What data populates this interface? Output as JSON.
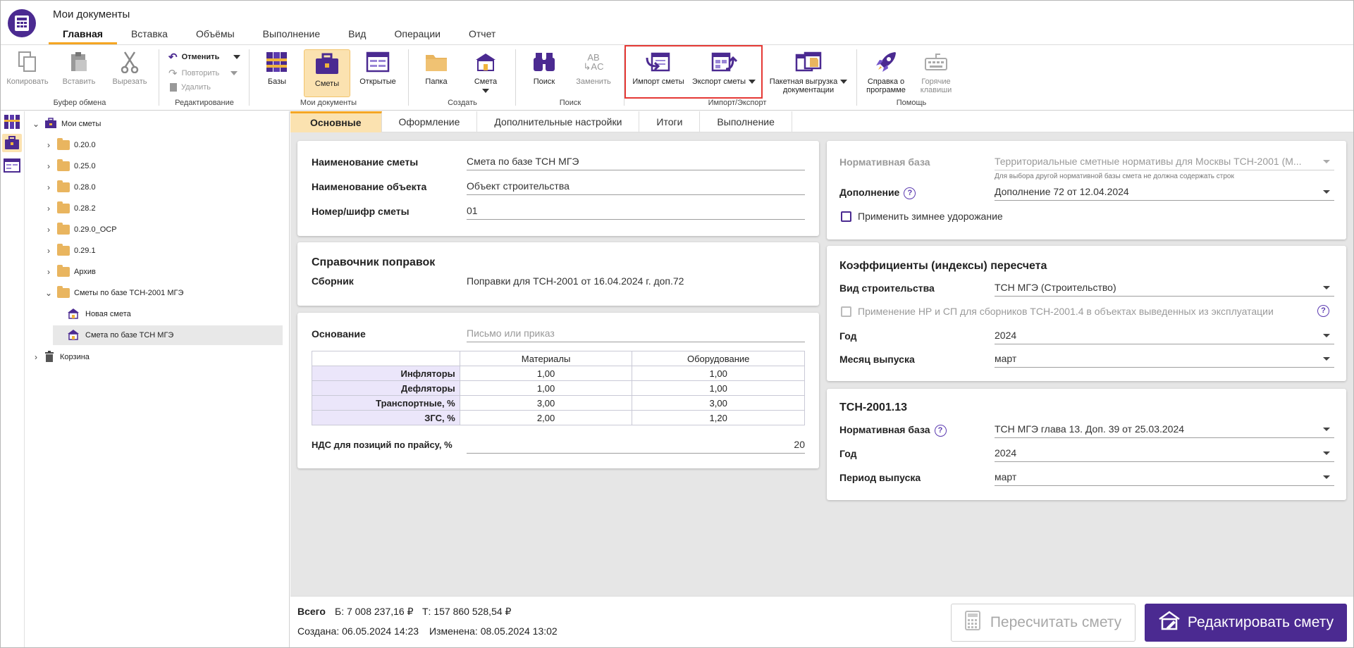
{
  "app": {
    "title": "Мои документы"
  },
  "ribbon_tabs": [
    "Главная",
    "Вставка",
    "Объёмы",
    "Выполнение",
    "Вид",
    "Операции",
    "Отчет"
  ],
  "ribbon": {
    "clipboard": {
      "copy": "Копировать",
      "paste": "Вставить",
      "cut": "Вырезать",
      "group": "Буфер обмена"
    },
    "editing": {
      "undo": "Отменить",
      "redo": "Повторить",
      "delete": "Удалить",
      "group": "Редактирование"
    },
    "my_docs": {
      "bases": "Базы",
      "estimates": "Сметы",
      "open": "Открытые",
      "group": "Мои документы"
    },
    "create": {
      "folder": "Папка",
      "estimate": "Смета",
      "group": "Создать"
    },
    "search": {
      "find": "Поиск",
      "replace": "Заменить",
      "group": "Поиск"
    },
    "import_export": {
      "import": "Импорт сметы",
      "export": "Экспорт сметы",
      "batch_line1": "Пакетная выгрузка",
      "batch_line2": "документации",
      "group": "Импорт/Экспорт"
    },
    "help": {
      "about_line1": "Справка о",
      "about_line2": "программе",
      "hotkeys_line1": "Горячие",
      "hotkeys_line2": "клавиши",
      "group": "Помощь"
    }
  },
  "tree": {
    "root": "Мои сметы",
    "folders": [
      "0.20.0",
      "0.25.0",
      "0.28.0",
      "0.28.2",
      "0.29.0_ОСР",
      "0.29.1",
      "Архив",
      "Сметы по базе ТСН-2001 МГЭ"
    ],
    "children": [
      "Новая смета",
      "Смета по базе ТСН МГЭ"
    ],
    "trash": "Корзина"
  },
  "content_tabs": [
    "Основные",
    "Оформление",
    "Дополнительные настройки",
    "Итоги",
    "Выполнение"
  ],
  "general": {
    "name_label": "Наименование сметы",
    "name_value": "Смета по базе ТСН МГЭ",
    "object_label": "Наименование объекта",
    "object_value": "Объект строительства",
    "number_label": "Номер/шифр сметы",
    "number_value": "01"
  },
  "corrections": {
    "title": "Справочник поправок",
    "label": "Сборник",
    "value": "Поправки для ТСН-2001 от 16.04.2024 г. доп.72"
  },
  "basis": {
    "label": "Основание",
    "placeholder": "Письмо или приказ",
    "columns": [
      "Материалы",
      "Оборудование"
    ],
    "rows": [
      {
        "name": "Инфляторы",
        "materials": "1,00",
        "equipment": "1,00"
      },
      {
        "name": "Дефляторы",
        "materials": "1,00",
        "equipment": "1,00"
      },
      {
        "name": "Транспортные, %",
        "materials": "3,00",
        "equipment": "3,00"
      },
      {
        "name": "ЗГС, %",
        "materials": "2,00",
        "equipment": "1,20"
      }
    ],
    "vat_label": "НДС для позиций по прайсу, %",
    "vat_value": "20"
  },
  "norm": {
    "base_label": "Нормативная база",
    "base_value": "Территориальные сметные нормативы для Москвы ТСН-2001 (М...",
    "base_hint": "Для выбора другой нормативной базы смета не должна содержать строк",
    "addition_label": "Дополнение",
    "addition_value": "Дополнение 72 от 12.04.2024",
    "winter_label": "Применить зимнее удорожание"
  },
  "coefficients": {
    "title": "Коэффициенты (индексы) пересчета",
    "type_label": "Вид строительства",
    "type_value": "ТСН МГЭ (Строительство)",
    "apply_label": "Применение НР и СП для сборников ТСН-2001.4 в объектах выведенных из эксплуатации",
    "year_label": "Год",
    "year_value": "2024",
    "month_label": "Месяц выпуска",
    "month_value": "март"
  },
  "tsn13": {
    "title": "ТСН-2001.13",
    "base_label": "Нормативная база",
    "base_value": "ТСН МГЭ глава 13. Доп. 39 от 25.03.2024",
    "year_label": "Год",
    "year_value": "2024",
    "period_label": "Период выпуска",
    "period_value": "март"
  },
  "footer": {
    "total_label": "Всего",
    "b_value": "Б: 7 008 237,16 ₽",
    "t_value": "Т: 157 860 528,54 ₽",
    "created": "Создана: 06.05.2024 14:23",
    "modified": "Изменена: 08.05.2024 13:02",
    "recalc": "Пересчитать смету",
    "edit": "Редактировать смету"
  },
  "colors": {
    "accent": "#4b2a91",
    "tab_highlight": "#f5a623",
    "import_highlight": "#e53935"
  }
}
